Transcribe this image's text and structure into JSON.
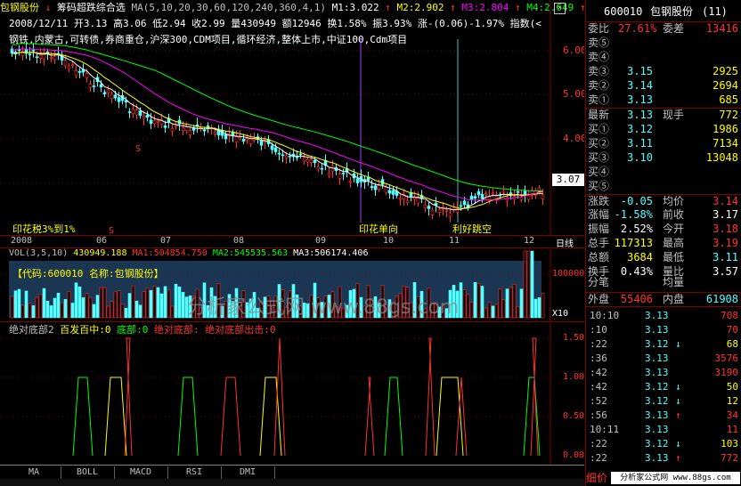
{
  "main_header": {
    "stock_name": "包钢股份",
    "formula_name": "筹码超跌综合选",
    "ma_label": "MA(5,10,20,30,60,120,240,360,4,1)",
    "m1": "M1:3.022",
    "m2": "M2:2.902",
    "m3": "M3:2.804",
    "m4": "M4:2.649",
    "up_arrow": "↑",
    "down_arrow": "↓"
  },
  "info_line": "2008/12/11 开3.13 高3.06 低2.94 收2.99 量430949 额12946 换1.58% 振3.93% 涨-(0.06)-1.97% 指数(<",
  "concept_line": "钢铁,内蒙古,可转债,券商重仓,沪深300,CDM项目,循环经济,整体上市,中证100,Cdm项目",
  "price_axis": [
    "6.00",
    "5.00",
    "4.00",
    "3.00"
  ],
  "current_price_tag": "3.07",
  "chart_annotations": [
    {
      "text": "印花税3%到1%"
    },
    {
      "text": "印花单向"
    },
    {
      "text": "利好跳空"
    },
    {
      "text": "S"
    },
    {
      "text": "S"
    }
  ],
  "date_axis": [
    "2008",
    "06",
    "07",
    "08",
    "09",
    "10",
    "11",
    "12"
  ],
  "date_axis_right": "日线",
  "vol_header": {
    "label": "VOL(3,5,10)",
    "value": "430949.188",
    "ma1": "MA1:504854.750",
    "ma2": "MA2:545535.563",
    "ma3": "MA3:506174.406"
  },
  "vol_info": "【代码:600010 名称:包钢股份】",
  "vol_axis": [
    "100000"
  ],
  "vol_unit": "X10",
  "watermark": "分析家公式网 www.88gs.com",
  "ind_header": {
    "name": "绝对底部2",
    "l1": "百发百中:0",
    "l2": "底部:0",
    "l3": "绝对底部:",
    "l4": "绝对底部出击:0"
  },
  "ind_axis": [
    "1.50",
    "1.00",
    "0.50",
    "0.00"
  ],
  "tabs": [
    "MA",
    "BOLL",
    "MACD",
    "RSI",
    "DMI"
  ],
  "quote_panel": {
    "code": "600010",
    "name": "包钢股份",
    "num": "(11)",
    "weibi_label": "委比",
    "weibi": "27.61%",
    "weicha_label": "委差",
    "weicha": "13416",
    "sells": [
      {
        "label": "卖⑤",
        "price": "",
        "vol": ""
      },
      {
        "label": "卖④",
        "price": "",
        "vol": ""
      },
      {
        "label": "卖③",
        "price": "3.15",
        "vol": "2925"
      },
      {
        "label": "卖②",
        "price": "3.14",
        "vol": "2694"
      },
      {
        "label": "卖①",
        "price": "3.13",
        "vol": "685"
      }
    ],
    "latest_label": "最新",
    "latest": "3.13",
    "xianshou_label": "现手",
    "xianshou": "772",
    "buys": [
      {
        "label": "买①",
        "price": "3.12",
        "vol": "1986"
      },
      {
        "label": "买②",
        "price": "3.11",
        "vol": "7134"
      },
      {
        "label": "买③",
        "price": "3.10",
        "vol": "13048"
      },
      {
        "label": "买④",
        "price": "",
        "vol": ""
      },
      {
        "label": "买⑤",
        "price": "",
        "vol": ""
      }
    ],
    "stats": [
      {
        "l1": "涨跌",
        "v1": "-0.05",
        "l2": "均价",
        "v2": "3.14"
      },
      {
        "l1": "涨幅",
        "v1": "-1.58%",
        "l2": "前收",
        "v2": "3.17"
      },
      {
        "l1": "振幅",
        "v1": "2.52%",
        "l2": "今开",
        "v2": "3.18"
      },
      {
        "l1": "总手",
        "v1": "117313",
        "l2": "最高",
        "v2": "3.19"
      },
      {
        "l1": "总额",
        "v1": "3684",
        "l2": "最低",
        "v2": "3.11"
      },
      {
        "l1": "换手",
        "v1": "0.43%",
        "l2": "量比",
        "v2": "3.57"
      }
    ],
    "fenbi": "分笔",
    "junliang": "均量",
    "waipan_label": "外盘",
    "waipan": "55406",
    "neipan_label": "内盘",
    "neipan": "61908",
    "ticks": [
      {
        "t": "10:10",
        "p": "3.13",
        "d": "",
        "v": "708"
      },
      {
        "t": ":10",
        "p": "3.13",
        "d": "",
        "v": "70"
      },
      {
        "t": ":22",
        "p": "3.12",
        "d": "↓",
        "v": "68"
      },
      {
        "t": ":36",
        "p": "3.13",
        "d": "",
        "v": "3576"
      },
      {
        "t": ":42",
        "p": "3.13",
        "d": "",
        "v": "3190"
      },
      {
        "t": ":42",
        "p": "3.12",
        "d": "↓",
        "v": "50"
      },
      {
        "t": ":52",
        "p": "3.12",
        "d": "↓",
        "v": "12"
      },
      {
        "t": ":56",
        "p": "3.13",
        "d": "↑",
        "v": "34"
      },
      {
        "t": "10:11",
        "p": "3.13",
        "d": "",
        "v": "11"
      },
      {
        "t": ":22",
        "p": "3.12",
        "d": "↓",
        "v": "103"
      },
      {
        "t": ":22",
        "p": "3.13",
        "d": "↑",
        "v": "772"
      }
    ],
    "bottom_left": "细价",
    "bottom_brand": "分析家公式网 www.88gs.com"
  },
  "colors": {
    "up": "#ff3232",
    "down": "#54ffff",
    "ma_white": "#ffffff",
    "ma_yellow": "#ffff00",
    "ma_magenta": "#ff00ff",
    "ma_green": "#00ff00",
    "frame": "#800000"
  }
}
